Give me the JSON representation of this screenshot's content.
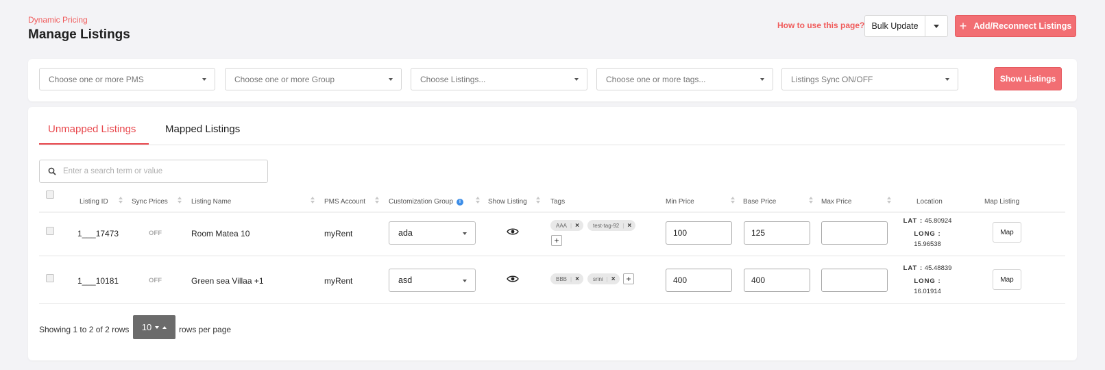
{
  "header": {
    "breadcrumb": "Dynamic Pricing",
    "title": "Manage Listings",
    "help_link": "How to use this page?",
    "bulk_update": "Bulk Update",
    "add_button": "Add/Reconnect Listings"
  },
  "filters": {
    "pms": "Choose one or more PMS",
    "group": "Choose one or more Group",
    "listings": "Choose Listings...",
    "tags": "Choose one or more tags...",
    "sync": "Listings Sync ON/OFF",
    "show_button": "Show Listings"
  },
  "tabs": [
    {
      "label": "Unmapped Listings",
      "active": true
    },
    {
      "label": "Mapped Listings",
      "active": false
    }
  ],
  "search": {
    "placeholder": "Enter a search term or value"
  },
  "columns": {
    "listing_id": "Listing ID",
    "sync_prices": "Sync Prices",
    "listing_name": "Listing Name",
    "pms_account": "PMS Account",
    "customization_group": "Customization Group",
    "show_listing": "Show Listing",
    "tags": "Tags",
    "min_price": "Min Price",
    "base_price": "Base Price",
    "max_price": "Max Price",
    "location": "Location",
    "map_listing": "Map Listing"
  },
  "rows": [
    {
      "listing_id": "1___17473",
      "sync": "OFF",
      "name": "Room Matea 10",
      "pms": "myRent",
      "group": "ada",
      "tags": [
        "AAA",
        "test-tag-92"
      ],
      "tag_sep": "|",
      "tag_remove": "×",
      "add_tag": "+",
      "min": "100",
      "base": "125",
      "max": "",
      "lat_label": "LAT :",
      "lat": "45.80924",
      "long_label": "LONG :",
      "long": "15.96538",
      "map_button": "Map"
    },
    {
      "listing_id": "1___10181",
      "sync": "OFF",
      "name": "Green sea Villaa +1",
      "pms": "myRent",
      "group": "asd",
      "tags": [
        "BBB",
        "srini"
      ],
      "tag_sep": "|",
      "tag_remove": "×",
      "add_tag": "+",
      "min": "400",
      "base": "400",
      "max": "",
      "lat_label": "LAT :",
      "lat": "45.48839",
      "long_label": "LONG :",
      "long": "16.01914",
      "map_button": "Map"
    }
  ],
  "pagination": {
    "showing": "Showing 1 to 2 of 2 rows",
    "rows_per_page": "10",
    "rows_per_page_label": "rows per page"
  },
  "colors": {
    "accent": "#f26e73",
    "accent_text": "#e8474c",
    "info_blue": "#3d8ee8"
  },
  "icons": [
    "search-icon",
    "info-icon",
    "eye-icon",
    "sort-icon",
    "chevron-down-icon",
    "plus-icon",
    "close-icon"
  ]
}
